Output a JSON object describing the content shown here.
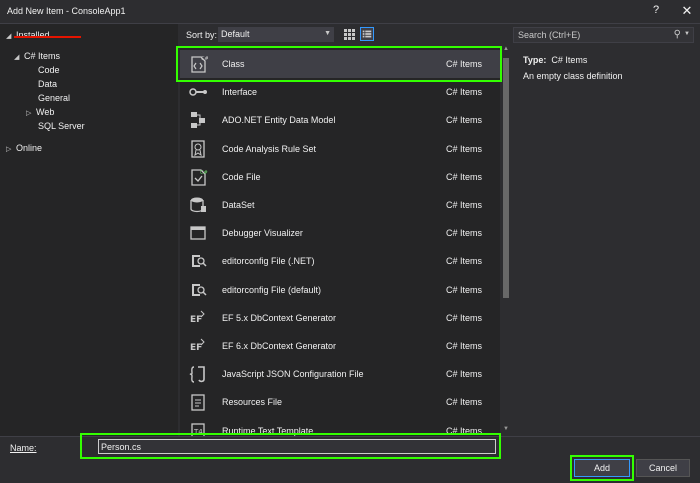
{
  "window": {
    "title": "Add New Item - ConsoleApp1",
    "help": "?",
    "close": "✕"
  },
  "tree": {
    "installed": "Installed",
    "csharp_items": "C# Items",
    "children": [
      "Code",
      "Data",
      "General",
      "Web",
      "SQL Server"
    ],
    "online": "Online"
  },
  "toolbar": {
    "sort_label": "Sort by:",
    "sort_value": "Default"
  },
  "search": {
    "placeholder": "Search (Ctrl+E)"
  },
  "details": {
    "type_label": "Type:",
    "type_value": "C# Items",
    "description": "An empty class definition"
  },
  "items": [
    {
      "name": "Class",
      "lang": "C# Items",
      "icon": "class-icon",
      "selected": true
    },
    {
      "name": "Interface",
      "lang": "C# Items",
      "icon": "interface-icon"
    },
    {
      "name": "ADO.NET Entity Data Model",
      "lang": "C# Items",
      "icon": "entity-model-icon"
    },
    {
      "name": "Code Analysis Rule Set",
      "lang": "C# Items",
      "icon": "rule-set-icon"
    },
    {
      "name": "Code File",
      "lang": "C# Items",
      "icon": "code-file-icon"
    },
    {
      "name": "DataSet",
      "lang": "C# Items",
      "icon": "dataset-icon"
    },
    {
      "name": "Debugger Visualizer",
      "lang": "C# Items",
      "icon": "window-icon"
    },
    {
      "name": "editorconfig File (.NET)",
      "lang": "C# Items",
      "icon": "editorconfig-icon"
    },
    {
      "name": "editorconfig File (default)",
      "lang": "C# Items",
      "icon": "editorconfig-icon"
    },
    {
      "name": "EF 5.x DbContext Generator",
      "lang": "C# Items",
      "icon": "ef-generator-icon"
    },
    {
      "name": "EF 6.x DbContext Generator",
      "lang": "C# Items",
      "icon": "ef-generator-icon"
    },
    {
      "name": "JavaScript JSON Configuration File",
      "lang": "C# Items",
      "icon": "json-config-icon"
    },
    {
      "name": "Resources File",
      "lang": "C# Items",
      "icon": "resources-file-icon"
    },
    {
      "name": "Runtime Text Template",
      "lang": "C# Items",
      "icon": "text-template-icon"
    }
  ],
  "bottom": {
    "name_label": "Name:",
    "name_value": "Person.cs",
    "add_label": "Add",
    "cancel_label": "Cancel"
  },
  "colors": {
    "background": "#2d2d30",
    "panel": "#252526",
    "selected_row": "#3f3f46",
    "highlight_box": "#33ff00",
    "annotation_underline": "#e51400",
    "accent": "#3399ff"
  }
}
